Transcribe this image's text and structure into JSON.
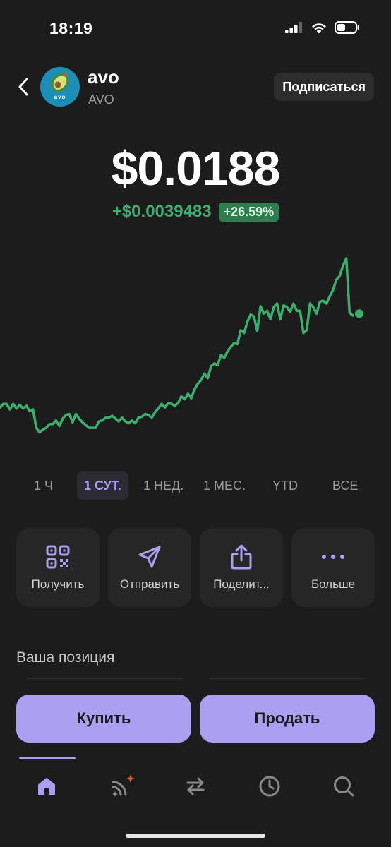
{
  "status": {
    "time": "18:19",
    "signal_icon": "cellular-signal-icon",
    "wifi_icon": "wifi-icon",
    "battery_icon": "battery-icon"
  },
  "header": {
    "back_icon": "chevron-left-icon",
    "logo_icon": "avo-token-logo",
    "logo_text": "avo",
    "name": "avo",
    "ticker": "AVO",
    "subscribe_label": "Подписаться"
  },
  "price": {
    "value": "$0.0188",
    "change_abs": "+$0.0039483",
    "change_pct": "+26.59%"
  },
  "colors": {
    "accent": "#ab9ff2",
    "positive": "#3bb06e",
    "background": "#1c1c1c"
  },
  "chart_data": {
    "type": "line",
    "range": "1 СУТ.",
    "series": [
      {
        "values": [
          0.01488,
          0.01492,
          0.01492,
          0.01486,
          0.01492,
          0.01487,
          0.01491,
          0.01487,
          0.0149,
          0.01484,
          0.01486,
          0.01466,
          0.01461,
          0.01464,
          0.01466,
          0.0147,
          0.0147,
          0.01474,
          0.01468,
          0.01476,
          0.0148,
          0.01481,
          0.01472,
          0.01481,
          0.01476,
          0.01472,
          0.01469,
          0.01466,
          0.01466,
          0.01466,
          0.01473,
          0.01474,
          0.01477,
          0.01477,
          0.01479,
          0.01476,
          0.01473,
          0.01477,
          0.01473,
          0.01471,
          0.01474,
          0.01471,
          0.01477,
          0.01478,
          0.01481,
          0.0148,
          0.01477,
          0.01483,
          0.01487,
          0.01492,
          0.01488,
          0.01493,
          0.01492,
          0.0149,
          0.01493,
          0.015,
          0.01497,
          0.01503,
          0.01498,
          0.01508,
          0.01514,
          0.01518,
          0.01525,
          0.0152,
          0.01533,
          0.01536,
          0.01534,
          0.01545,
          0.01542,
          0.01549,
          0.01554,
          0.01558,
          0.01557,
          0.01572,
          0.01569,
          0.01581,
          0.01589,
          0.01587,
          0.01571,
          0.01598,
          0.0159,
          0.01593,
          0.01584,
          0.01597,
          0.01601,
          0.01584,
          0.01599,
          0.01597,
          0.01592,
          0.01601,
          0.01593,
          0.01593,
          0.01569,
          0.01572,
          0.01601,
          0.01597,
          0.0159,
          0.01603,
          0.01604,
          0.01601,
          0.01609,
          0.01616,
          0.01627,
          0.01631,
          0.01642,
          0.0165,
          0.01591,
          0.01588
        ]
      }
    ],
    "ylim": [
      0.0144,
      0.0167
    ],
    "grid": false,
    "end_point": 0.0159
  },
  "ranges": [
    {
      "label": "1 Ч",
      "active": false
    },
    {
      "label": "1 СУТ.",
      "active": true
    },
    {
      "label": "1 НЕД.",
      "active": false
    },
    {
      "label": "1 МЕС.",
      "active": false
    },
    {
      "label": "YTD",
      "active": false
    },
    {
      "label": "ВСЕ",
      "active": false
    }
  ],
  "actions": [
    {
      "label": "Получить",
      "icon": "qr-code-icon"
    },
    {
      "label": "Отправить",
      "icon": "send-paper-plane-icon"
    },
    {
      "label": "Поделит...",
      "icon": "share-icon"
    },
    {
      "label": "Больше",
      "icon": "more-dots-icon"
    }
  ],
  "position": {
    "title": "Ваша позиция"
  },
  "trade": {
    "buy_label": "Купить",
    "sell_label": "Продать"
  },
  "tabs": [
    {
      "name": "home",
      "icon": "home-icon",
      "active": true
    },
    {
      "name": "feed",
      "icon": "feed-icon",
      "active": false,
      "badge": true
    },
    {
      "name": "swap",
      "icon": "swap-icon",
      "active": false
    },
    {
      "name": "activity",
      "icon": "clock-icon",
      "active": false
    },
    {
      "name": "search",
      "icon": "search-icon",
      "active": false
    }
  ]
}
